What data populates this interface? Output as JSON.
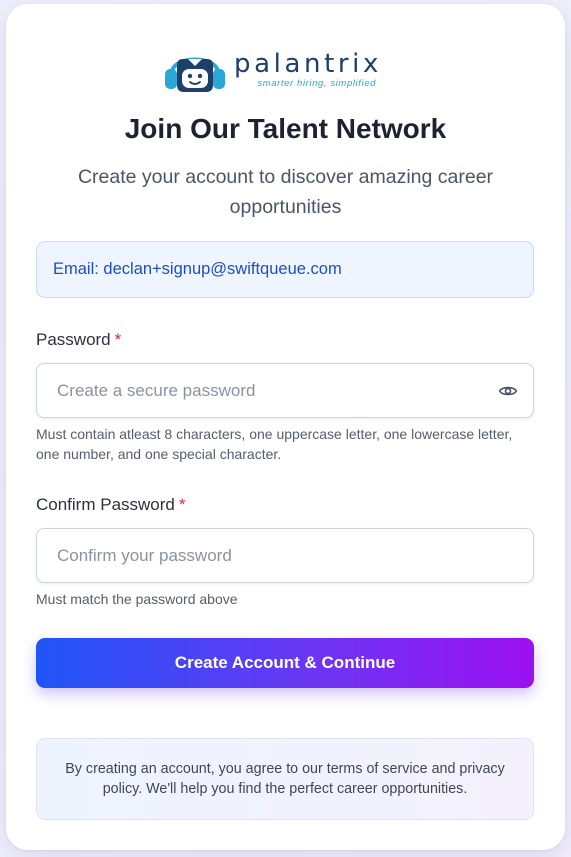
{
  "brand": {
    "name": "palantrix",
    "tagline": "smarter hiring, simplified",
    "colors": {
      "navy": "#1d3f68",
      "cyan": "#2aa7d6",
      "accent_start": "#1f55f6",
      "accent_end": "#9c10f0"
    },
    "logo_icon": "headset-robot-icon"
  },
  "header": {
    "title": "Join Our Talent Network",
    "subtitle": "Create your account to discover amazing career opportunities"
  },
  "email": {
    "text": "Email: declan+signup@swiftqueue.com"
  },
  "password": {
    "label": "Password",
    "required_mark": "*",
    "value": "",
    "placeholder": "Create a secure password",
    "toggle_icon": "eye-icon",
    "hint": "Must contain atleast 8 characters, one uppercase letter, one lowercase letter, one number, and one special character."
  },
  "confirm_password": {
    "label": "Confirm Password",
    "required_mark": "*",
    "value": "",
    "placeholder": "Confirm your password",
    "hint": "Must match the password above"
  },
  "submit": {
    "label": "Create Account & Continue"
  },
  "terms": {
    "text": "By creating an account, you agree to our terms of service and privacy policy. We'll help you find the perfect career opportunities."
  }
}
